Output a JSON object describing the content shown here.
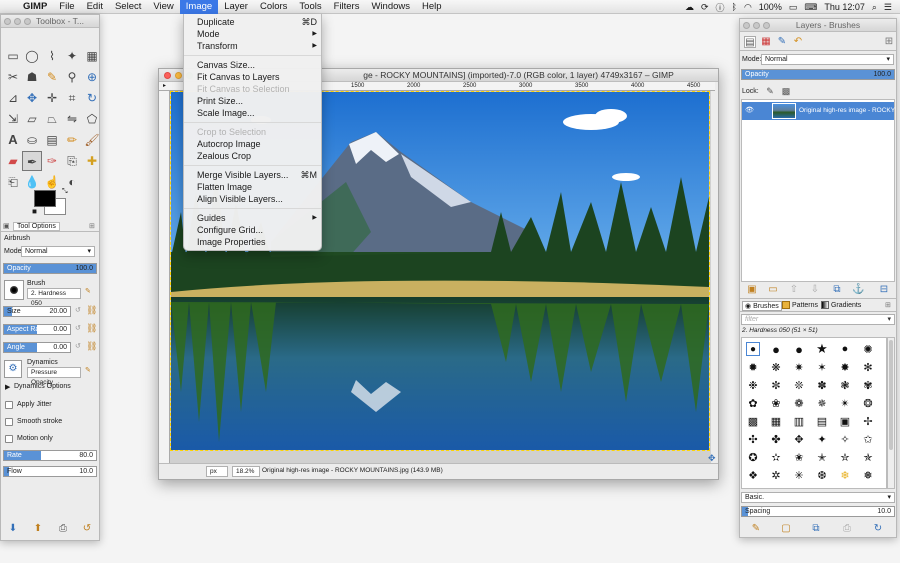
{
  "menubar": {
    "apple": "",
    "app": "GIMP",
    "items": [
      "File",
      "Edit",
      "Select",
      "View",
      "Image",
      "Layer",
      "Colors",
      "Tools",
      "Filters",
      "Windows",
      "Help"
    ],
    "active": "Image",
    "battery": "100%",
    "clock": "Thu 12:07"
  },
  "toolbox": {
    "title": "Toolbox - T...",
    "tab_label": "Tool Options",
    "tool_name": "Airbrush",
    "mode_label": "Mode:",
    "mode_value": "Normal",
    "opacity_label": "Opacity",
    "opacity_value": "100.0",
    "opacity_fraction": 1.0,
    "brush_label": "Brush",
    "brush_value": "2. Hardness 050",
    "size_label": "Size",
    "size_value": "20.00",
    "aspect_label": "Aspect Ratio",
    "aspect_value": "0.00",
    "angle_label": "Angle",
    "angle_value": "0.00",
    "dynamics_label": "Dynamics",
    "dynamics_value": "Pressure Opacity",
    "dynamics_options": "Dynamics Options",
    "apply_jitter": "Apply Jitter",
    "smooth_stroke": "Smooth stroke",
    "motion_only": "Motion only",
    "rate_label": "Rate",
    "rate_value": "80.0",
    "rate_fraction": 0.4,
    "flow_label": "Flow",
    "flow_value": "10.0",
    "flow_fraction": 0.05
  },
  "image_menu": {
    "items": [
      {
        "label": "Duplicate",
        "shortcut": "⌘D",
        "disabled": false
      },
      {
        "label": "Mode",
        "shortcut": "▶",
        "disabled": false
      },
      {
        "label": "Transform",
        "shortcut": "▶",
        "disabled": false
      },
      {
        "label": "Canvas Size...",
        "shortcut": "",
        "disabled": false
      },
      {
        "label": "Fit Canvas to Layers",
        "shortcut": "",
        "disabled": false
      },
      {
        "label": "Fit Canvas to Selection",
        "shortcut": "",
        "disabled": true
      },
      {
        "label": "Print Size...",
        "shortcut": "",
        "disabled": false
      },
      {
        "label": "Scale Image...",
        "shortcut": "",
        "disabled": false
      },
      {
        "label": "Crop to Selection",
        "shortcut": "",
        "disabled": true
      },
      {
        "label": "Autocrop Image",
        "shortcut": "",
        "disabled": false
      },
      {
        "label": "Zealous Crop",
        "shortcut": "",
        "disabled": false
      },
      {
        "label": "Merge Visible Layers...",
        "shortcut": "⌘M",
        "disabled": false
      },
      {
        "label": "Flatten Image",
        "shortcut": "",
        "disabled": false
      },
      {
        "label": "Align Visible Layers...",
        "shortcut": "",
        "disabled": false
      },
      {
        "label": "Guides",
        "shortcut": "▶",
        "disabled": false
      },
      {
        "label": "Configure Grid...",
        "shortcut": "",
        "disabled": false
      },
      {
        "label": "Image Properties",
        "shortcut": "",
        "disabled": false
      }
    ]
  },
  "image_window": {
    "title": "ge - ROCKY MOUNTAINS] (imported)-7.0 (RGB color, 1 layer) 4749x3167 – GIMP",
    "ruler_labels": [
      "1500",
      "2000",
      "2500",
      "3000",
      "3500",
      "4000",
      "4500"
    ],
    "unit": "px",
    "zoom": "18.2%",
    "status": "Original high-res image - ROCKY MOUNTAINS.jpg (143.9 MB)"
  },
  "layers": {
    "title": "Layers - Brushes",
    "mode_label": "Mode:",
    "mode_value": "Normal",
    "opacity_label": "Opacity",
    "opacity_value": "100.0",
    "lock_label": "Lock:",
    "layer_name": "Original high-res image - ROCKY"
  },
  "brushes": {
    "tabs": [
      "Brushes",
      "Patterns",
      "Gradients"
    ],
    "filter_placeholder": "filter",
    "selected": "2. Hardness 050 (51 × 51)",
    "tag": "Basic.",
    "spacing_label": "Spacing",
    "spacing_value": "10.0"
  },
  "colors": {
    "accent": "#3b78e7",
    "selection": "#4a86d4"
  }
}
